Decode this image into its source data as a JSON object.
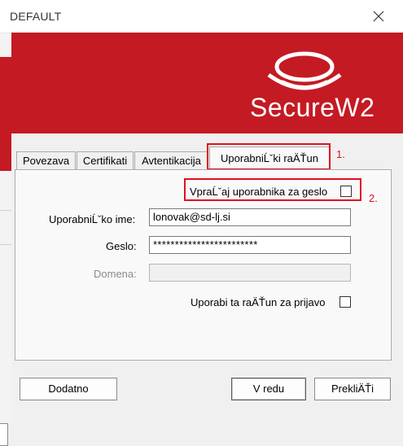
{
  "window": {
    "title": "DEFAULT"
  },
  "banner": {
    "logo_text": "SecureW2",
    "color": "#c41a23"
  },
  "tabs": [
    {
      "label": "Povezava"
    },
    {
      "label": "Certifikati"
    },
    {
      "label": "Avtentikacija"
    },
    {
      "label": "UporabniĹˇki raÄŤun",
      "active": true
    }
  ],
  "form": {
    "prompt_checkbox_label": "VpraĹˇaj uporabnika za geslo",
    "username_label": "UporabniĹˇko ime:",
    "username_value": "lonovak@sd-lj.si",
    "password_label": "Geslo:",
    "password_value": "************************",
    "domain_label": "Domena:",
    "domain_value": "",
    "use_account_label": "Uporabi ta raÄŤun za prijavo"
  },
  "annotations": {
    "step1": "1.",
    "step2": "2.",
    "color": "#e0101f"
  },
  "buttons": {
    "advanced": "Dodatno",
    "ok": "V redu",
    "cancel": "PrekliÄŤi"
  }
}
